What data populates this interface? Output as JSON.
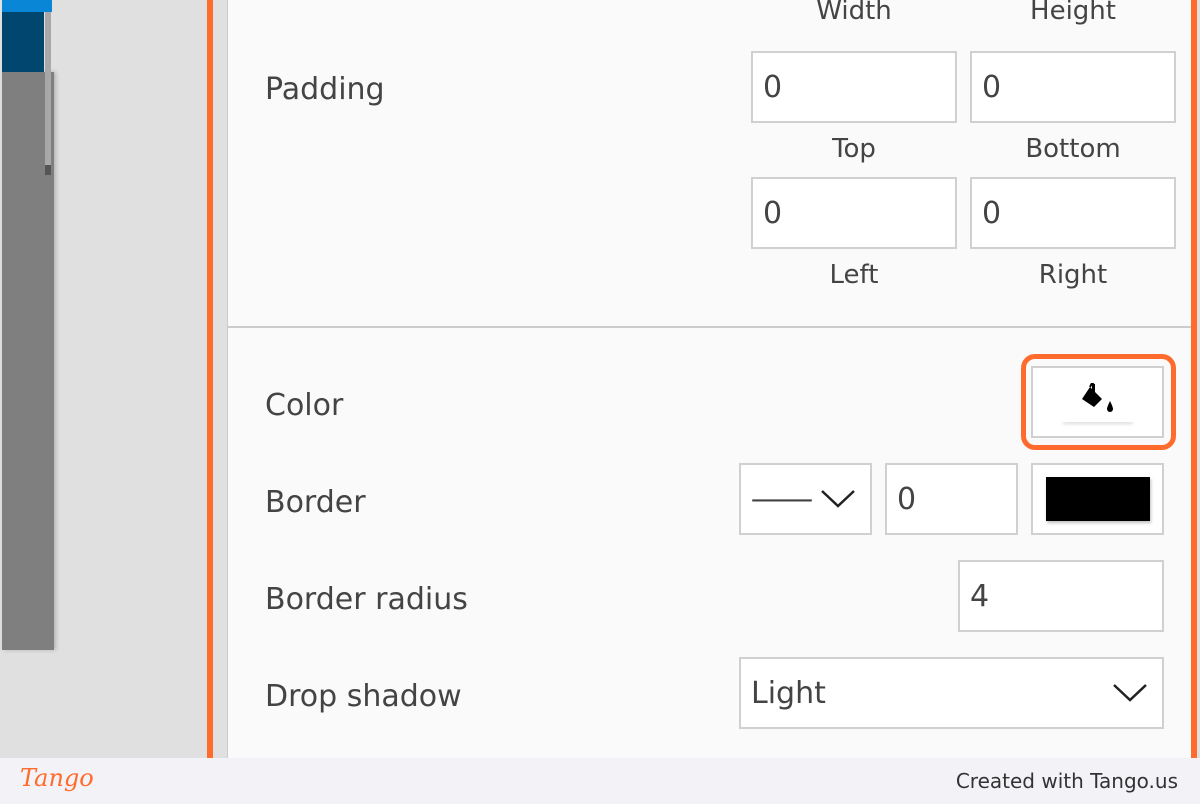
{
  "padding": {
    "label": "Padding",
    "captions_top": [
      "Width",
      "Height"
    ],
    "width": "0",
    "height": "0",
    "captions_mid": [
      "Top",
      "Bottom"
    ],
    "top": "0",
    "bottom": "0",
    "captions_bottom": [
      "Left",
      "Right"
    ]
  },
  "color": {
    "label": "Color",
    "icon": "paint-bucket-icon"
  },
  "border": {
    "label": "Border",
    "style": "—",
    "width": "0",
    "color": "#000000"
  },
  "border_radius": {
    "label": "Border radius",
    "value": "4"
  },
  "drop_shadow": {
    "label": "Drop shadow",
    "value": "Light"
  },
  "footer": {
    "logo": "Tango",
    "credit": "Created with Tango.us"
  },
  "colors": {
    "accent": "#ff6b2c"
  }
}
